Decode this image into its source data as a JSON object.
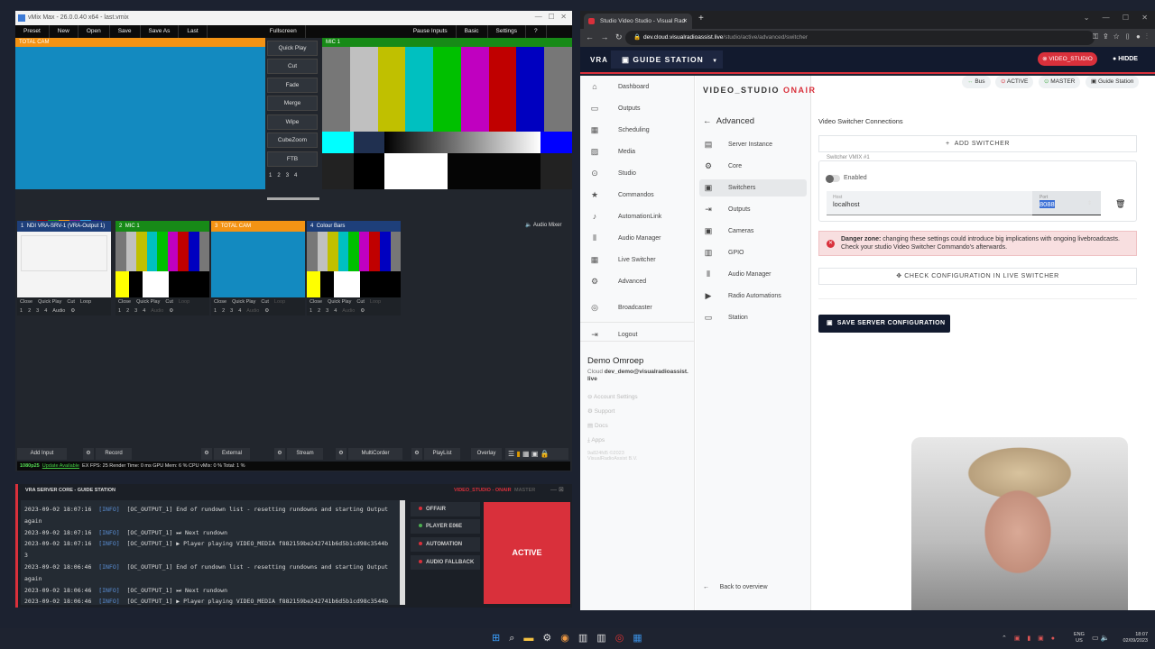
{
  "vmix": {
    "title": "vMix Max - 26.0.0.40 x64 - last.vmix",
    "menu": [
      "Preset",
      "New",
      "Open",
      "Save",
      "Save As",
      "Last",
      "Fullscreen",
      "Pause Inputs",
      "Basic",
      "Settings",
      "?"
    ],
    "preview_label": "TOTAL CAM",
    "program_label": "MIC 1",
    "transitions": [
      "Quick Play",
      "Cut",
      "Fade",
      "Merge",
      "Wipe",
      "CubeZoom",
      "FTB"
    ],
    "transition_numbers": [
      "1",
      "2",
      "3",
      "4"
    ],
    "audio_mixer": "Audio Mixer",
    "inputs": [
      {
        "num": "1",
        "name": "NDI VRA-SRV-1 (VRA-Output 1)",
        "color": "#1e3f7a"
      },
      {
        "num": "2",
        "name": "MIC 1",
        "color": "#178a17"
      },
      {
        "num": "3",
        "name": "TOTAL CAM",
        "color": "#f39314"
      },
      {
        "num": "4",
        "name": "Colour Bars",
        "color": "#1e3f7a"
      }
    ],
    "input_controls": [
      "Close",
      "Quick Play",
      "Cut",
      "Loop"
    ],
    "input_buses": [
      "1",
      "2",
      "3",
      "4",
      "Audio"
    ],
    "toolbar": [
      "Add Input",
      "Record",
      "External",
      "Stream",
      "MultiCorder",
      "PlayList",
      "Overlay"
    ],
    "status": {
      "format": "1080p25",
      "update": "Update Available",
      "text": "EX FPS: 25  Render Time: 0 ms  GPU Mem: 6 %  CPU vMix: 0 %  Total: 1 %"
    }
  },
  "core": {
    "title": "VRA SERVER CORE - GUIDE STATION",
    "studio": "VIDEO_STUDIO - ONAIR",
    "master": "MASTER",
    "logs": [
      {
        "time": "2023-09-02 18:07:16",
        "level": "[INFO]",
        "msg": "[OC_OUTPUT_1] End of rundown list - resetting rundowns and starting Output"
      },
      {
        "time": "",
        "level": "",
        "msg": "again"
      },
      {
        "time": "2023-09-02 18:07:16",
        "level": "[INFO]",
        "msg": "[OC_OUTPUT_1] ⏭ Next rundown"
      },
      {
        "time": "2023-09-02 18:07:16",
        "level": "[INFO]",
        "msg": "[OC_OUTPUT_1] ▶ Player playing VIDEO_MEDIA f882159be242741b6d5b1cd98c3544b"
      },
      {
        "time": "",
        "level": "",
        "msg": "3"
      },
      {
        "time": "2023-09-02 18:06:46",
        "level": "[INFO]",
        "msg": "[OC_OUTPUT_1] End of rundown list - resetting rundowns and starting Output"
      },
      {
        "time": "",
        "level": "",
        "msg": "again"
      },
      {
        "time": "2023-09-02 18:06:46",
        "level": "[INFO]",
        "msg": "[OC_OUTPUT_1] ⏭ Next rundown"
      },
      {
        "time": "2023-09-02 18:06:46",
        "level": "[INFO]",
        "msg": "[OC_OUTPUT_1] ▶ Player playing VIDEO_MEDIA f882159be242741b6d5b1cd98c3544b"
      }
    ],
    "states": [
      {
        "label": "OFFAIR",
        "color": "#d9303b"
      },
      {
        "label": "PLAYER E06E",
        "color": "#4caf50"
      },
      {
        "label": "AUTOMATION",
        "color": "#d9303b"
      },
      {
        "label": "AUDIO FALLBACK",
        "color": "#d9303b"
      }
    ],
    "active": "ACTIVE"
  },
  "browser": {
    "tab": "Studio Video Studio - Visual Rad",
    "url_host": "dev.cloud.visualradioassist.live",
    "url_path": "/studio/active/advanced/switcher"
  },
  "app": {
    "brand": "VRA",
    "station": "GUIDE STATION",
    "studio_badge": "VIDEO_STUDIO",
    "user": "HIDDE",
    "nav": [
      "Dashboard",
      "Outputs",
      "Scheduling",
      "Media",
      "Studio",
      "Commandos",
      "AutomationLink",
      "Audio Manager",
      "Live Switcher",
      "Advanced",
      "Broadcaster",
      "Logout"
    ],
    "org": "Demo Omroep",
    "account_prefix": "Cloud",
    "account": "dev_demo@visualradioassist.live",
    "links": [
      "Account Settings",
      "Support",
      "Docs",
      "Apps"
    ],
    "version": "9a824fd5 ©2023 VisualRadioAssist B.V.",
    "page_title": "VIDEO_STUDIO",
    "page_state": "ONAIR",
    "pills": [
      "Bus",
      "ACTIVE",
      "MASTER",
      "Guide Station"
    ],
    "sub_title": "Advanced",
    "sub_nav": [
      "Server Instance",
      "Core",
      "Switchers",
      "Outputs",
      "Cameras",
      "GPIO",
      "Audio Manager",
      "Radio Automations",
      "Station"
    ],
    "back": "Back to overview",
    "section": "Video Switcher Connections",
    "add_switcher": "ADD SWITCHER",
    "switcher_legend": "Switcher VMIX #1",
    "enabled": "Enabled",
    "host_label": "Host",
    "host": "localhost",
    "port_label": "Port",
    "port": "8088",
    "danger_strong": "Danger zone:",
    "danger_text": " changing these settings could introduce big implications with ongoing livebroadcasts. Check your studio Video Switcher Commando's afterwards.",
    "check": "CHECK CONFIGURATION IN LIVE SWITCHER",
    "save": "SAVE SERVER CONFIGURATION",
    "accent": "#d9303b"
  },
  "taskbar": {
    "lang": "ENG",
    "region": "US",
    "time": "18:07",
    "date": "02/09/2023"
  }
}
